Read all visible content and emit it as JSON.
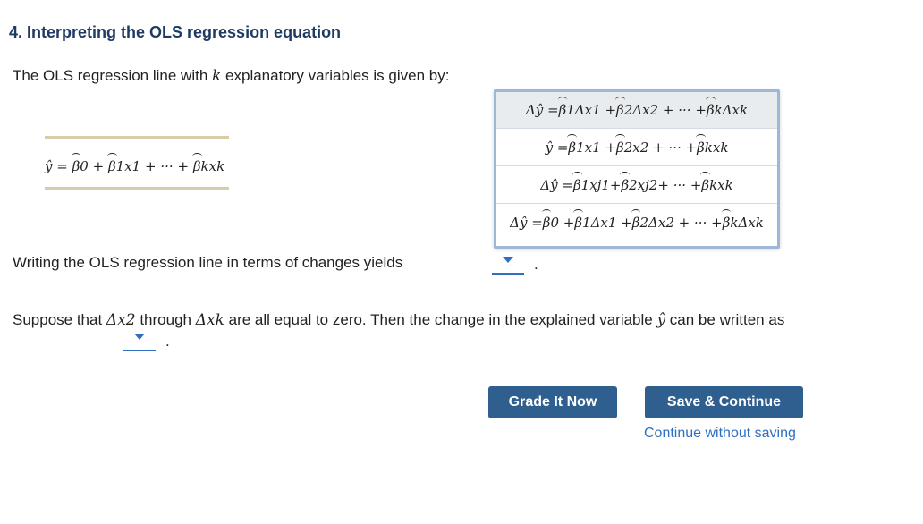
{
  "title": "4. Interpreting the OLS regression equation",
  "intro": {
    "before": "The OLS regression line with ",
    "k": "k",
    "after": " explanatory variables is given by:"
  },
  "equation": "ŷ = β0 + β1x1 + ··· + βkxk",
  "dropdown": {
    "options": [
      "Δŷ = β1Δx1 + β2Δx2 + ··· + βkΔxk",
      "ŷ = β1x1 + β2x2 + ··· + βkxk",
      "Δŷ = β1xj1+ β2xj2+ ··· + βkxk",
      "Δŷ = β0 + β1Δx1 + β2Δx2 + ··· + βkΔxk"
    ],
    "highlighted_index": 0
  },
  "question1": {
    "text": "Writing the OLS regression line in terms of changes yields",
    "end": "."
  },
  "question2": {
    "p1": "Suppose that ",
    "dx2": "Δx2",
    "p2": " through ",
    "dxk": "Δxk",
    "p3": " are all equal to zero. Then the change in the explained variable ",
    "yhat": "ŷ",
    "p4": " can be written as",
    "end": "."
  },
  "buttons": {
    "grade": "Grade It Now",
    "save": "Save & Continue",
    "continue_link": "Continue without saving"
  },
  "colors": {
    "title": "#1f3b63",
    "button": "#2f5f8f",
    "link": "#2f6fc1",
    "dropdown_border": "#9fb7d6",
    "rule": "#d9ccaa"
  }
}
